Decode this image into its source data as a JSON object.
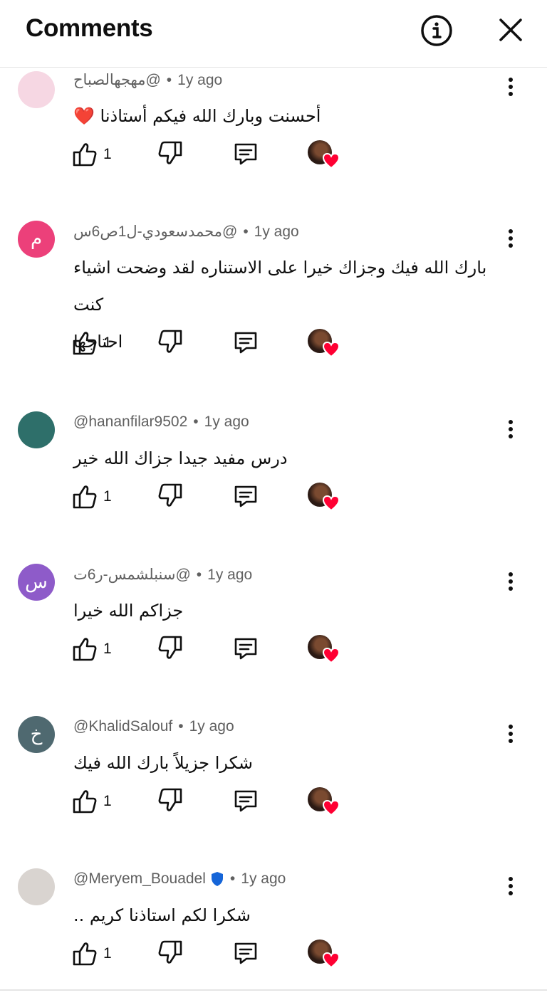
{
  "header": {
    "title": "Comments"
  },
  "comments": [
    {
      "author": "@مهجهالصباح",
      "time": "1y ago",
      "lines": [
        "أحسنت وبارك الله فيكم أستاذنا ❤️"
      ],
      "likes": "1",
      "avatar_letter": "",
      "avatar_color": "#f6d7e3",
      "verified": false
    },
    {
      "author": "@محمدسعودي-ل1ص6س",
      "time": "1y ago",
      "lines": [
        "بارك الله فيك وجزاك خيرا على الاستناره لقد وضحت اشياء كنت",
        "احتاجها"
      ],
      "likes": "1",
      "avatar_letter": "م",
      "avatar_color": "#ec407a",
      "verified": false
    },
    {
      "author": "@hananfilar9502",
      "time": "1y ago",
      "lines": [
        "درس مفيد جيدا جزاك الله خير"
      ],
      "likes": "1",
      "avatar_letter": "",
      "avatar_color": "#2e6f6a",
      "verified": false
    },
    {
      "author": "@سنبلشمس-ر6ت",
      "time": "1y ago",
      "lines": [
        "جزاكم الله خيرا"
      ],
      "likes": "1",
      "avatar_letter": "س",
      "avatar_color": "#8e5bc9",
      "verified": false
    },
    {
      "author": "@KhalidSalouf",
      "time": "1y ago",
      "lines": [
        "شكرا جزيلاً بارك الله فيك"
      ],
      "likes": "1",
      "avatar_letter": "خ",
      "avatar_color": "#4f6970",
      "verified": false
    },
    {
      "author": "@Meryem_Bouadel",
      "time": "1y ago",
      "lines": [
        "شكرا لكم استاذنا كريم  .."
      ],
      "likes": "1",
      "avatar_letter": "",
      "avatar_color": "#d9d4d0",
      "verified": true
    }
  ],
  "colors": {
    "heart": "#ff0033",
    "verified": "#1565d8",
    "meta_text": "#606060"
  },
  "icons": [
    "info-icon",
    "close-icon",
    "more-vert-icon",
    "thumb-up-icon",
    "thumb-down-icon",
    "reply-icon",
    "heart-icon",
    "verified-icon"
  ]
}
